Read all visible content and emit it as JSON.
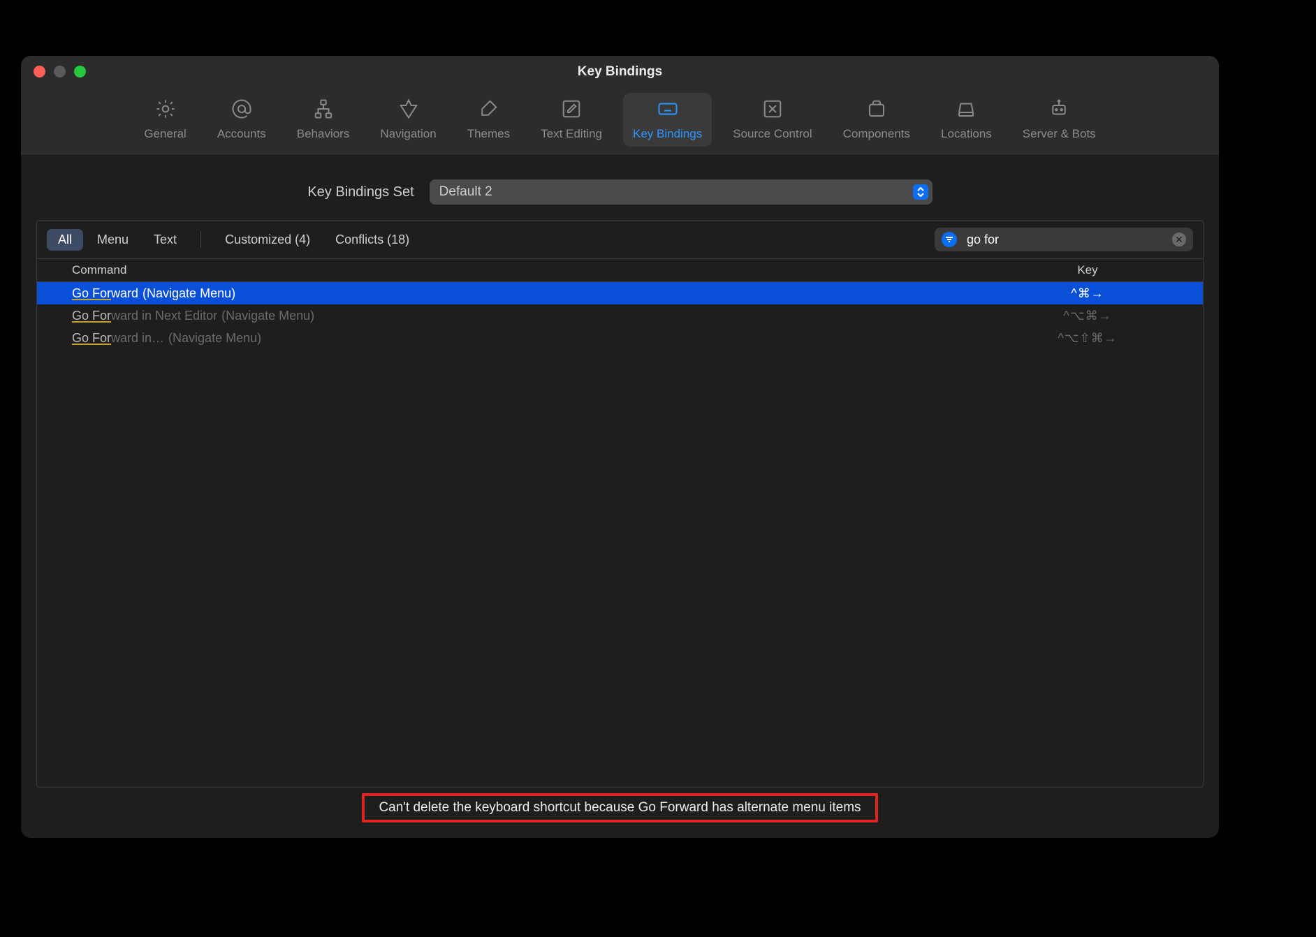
{
  "window": {
    "title": "Key Bindings"
  },
  "toolbar": {
    "items": [
      {
        "id": "general",
        "label": "General",
        "icon": "gear-icon"
      },
      {
        "id": "accounts",
        "label": "Accounts",
        "icon": "at-icon"
      },
      {
        "id": "behaviors",
        "label": "Behaviors",
        "icon": "flow-icon"
      },
      {
        "id": "navigation",
        "label": "Navigation",
        "icon": "nav-icon"
      },
      {
        "id": "themes",
        "label": "Themes",
        "icon": "brush-icon"
      },
      {
        "id": "textediting",
        "label": "Text Editing",
        "icon": "pencil-square-icon"
      },
      {
        "id": "keybindings",
        "label": "Key Bindings",
        "icon": "keyboard-icon",
        "active": true
      },
      {
        "id": "sourcecontrol",
        "label": "Source Control",
        "icon": "branch-icon"
      },
      {
        "id": "components",
        "label": "Components",
        "icon": "package-icon"
      },
      {
        "id": "locations",
        "label": "Locations",
        "icon": "disk-icon"
      },
      {
        "id": "serverbots",
        "label": "Server & Bots",
        "icon": "robot-icon"
      }
    ]
  },
  "set": {
    "label": "Key Bindings Set",
    "value": "Default 2"
  },
  "filters": {
    "scopes": [
      {
        "label": "All",
        "active": true
      },
      {
        "label": "Menu"
      },
      {
        "label": "Text"
      }
    ],
    "extra": [
      {
        "label": "Customized (4)"
      },
      {
        "label": "Conflicts (18)"
      }
    ]
  },
  "search": {
    "value": "go for",
    "placeholder": "Filter"
  },
  "table": {
    "headers": {
      "command": "Command",
      "key": "Key"
    },
    "rows": [
      {
        "match": "Go For",
        "rest": "ward",
        "menu": "(Navigate Menu)",
        "key": "^⌘→",
        "selected": true
      },
      {
        "match": "Go For",
        "rest": "ward in Next Editor",
        "menu": "(Navigate Menu)",
        "key": "^⌥⌘→"
      },
      {
        "match": "Go For",
        "rest": "ward in…",
        "menu": "(Navigate Menu)",
        "key": "^⌥⇧⌘→"
      }
    ]
  },
  "status": {
    "message": "Can't delete the keyboard shortcut because Go Forward has alternate menu items"
  }
}
